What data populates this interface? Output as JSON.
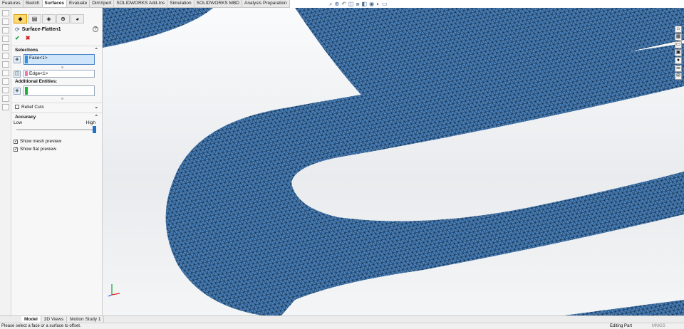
{
  "command_tabs": [
    {
      "label": "Features",
      "active": false
    },
    {
      "label": "Sketch",
      "active": false
    },
    {
      "label": "Surfaces",
      "active": true
    },
    {
      "label": "Evaluate",
      "active": false
    },
    {
      "label": "DimXpert",
      "active": false
    },
    {
      "label": "SOLIDWORKS Add-Ins",
      "active": false
    },
    {
      "label": "Simulation",
      "active": false
    },
    {
      "label": "SOLIDWORKS MBD",
      "active": false
    },
    {
      "label": "Analysis Preparation",
      "active": false
    }
  ],
  "property_manager": {
    "title": "Surface-Flatten1",
    "help": "?",
    "ok": "✔",
    "cancel": "✖",
    "selections": {
      "heading": "Selections",
      "face_value": "Face<1>",
      "edge_value": "Edge<1>",
      "additional_label": "Additional Entities:",
      "additional_value": ""
    },
    "relief_cuts": "Relief Cuts",
    "accuracy": {
      "heading": "Accuracy",
      "low": "Low",
      "high": "High",
      "level": 1.0
    },
    "show_mesh_preview": {
      "label": "Show mesh preview",
      "checked": true
    },
    "show_flat_preview": {
      "label": "Show flat preview",
      "checked": true
    }
  },
  "bottom_tabs": [
    {
      "label": "Model",
      "active": true
    },
    {
      "label": "3D Views",
      "active": false
    },
    {
      "label": "Motion Study 1",
      "active": false
    }
  ],
  "status_bar": {
    "message": "Please select a face or a surface to offset.",
    "mode": "Editing Part",
    "units": "MMGS"
  },
  "colors": {
    "mesh_fill": "#4a7fb8",
    "mesh_line": "#0d2740",
    "accent": "#1e73c8",
    "face_marker": "#2f8fe0",
    "edge_marker": "#ee79b0",
    "entities_marker": "#18b534"
  },
  "icons": [
    "zoom-fit-icon",
    "zoom-area-icon",
    "previous-view-icon",
    "section-view-icon",
    "view-orientation-icon",
    "display-style-icon",
    "hide-show-icon",
    "appearance-icon",
    "scene-icon",
    "home-icon",
    "design-library-icon",
    "file-explorer-icon",
    "view-palette-icon",
    "appearances-icon",
    "custom-properties-icon",
    "forum-icon"
  ]
}
